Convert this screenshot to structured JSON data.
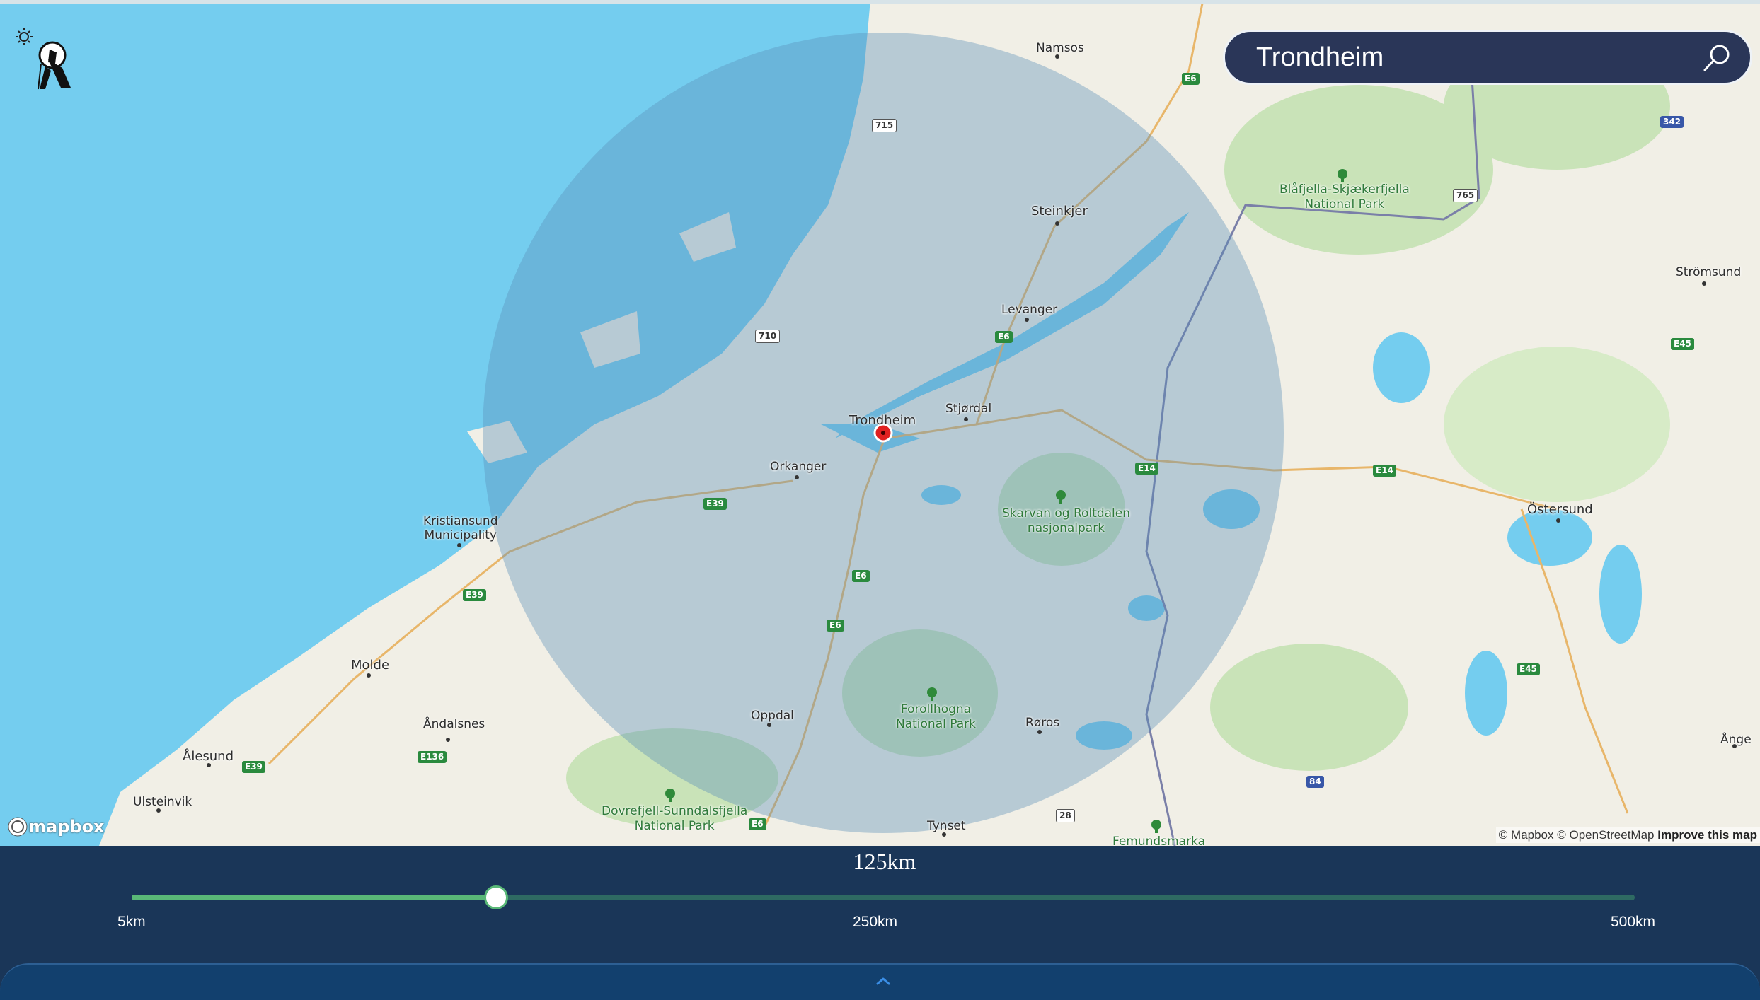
{
  "search": {
    "value": "Trondheim"
  },
  "map": {
    "center_label": "Trondheim",
    "places": {
      "namsos": "Namsos",
      "steinkjer": "Steinkjer",
      "levanger": "Levanger",
      "stjordal": "Stjørdal",
      "orkanger": "Orkanger",
      "kristiansund": "Kristiansund\nMunicipality",
      "molde": "Molde",
      "andalsnes": "Åndalsnes",
      "alesund": "Ålesund",
      "ulsteinvik": "Ulsteinvik",
      "oppdal": "Oppdal",
      "roros": "Røros",
      "tynset": "Tynset",
      "ostersund": "Östersund",
      "stromsund": "Strömsund",
      "ange": "Ånge"
    },
    "parks": {
      "blafjella": "Blåfjella-Skjækerfjella\nNational Park",
      "skarvan": "Skarvan og Roltdalen\nnasjonalpark",
      "forollhogna": "Forollhogna\nNational Park",
      "dovrefjell": "Dovrefjell-Sunndalsfjella\nNational Park",
      "femundsmarka": "Femundsmarka"
    },
    "shields": {
      "e6_a": "E6",
      "e6_b": "E6",
      "e6_c": "E6",
      "e6_d": "E6",
      "e6_e": "E6",
      "e14_a": "E14",
      "e14_b": "E14",
      "e39_a": "E39",
      "e39_b": "E39",
      "e39_c": "E39",
      "e136": "E136",
      "e45_a": "E45",
      "e45_b": "E45",
      "r715": "715",
      "r710": "710",
      "r765": "765",
      "r28": "28",
      "s342": "342",
      "s84": "84"
    },
    "mapbox_logo": "mapbox",
    "attribution_a": "© Mapbox © OpenStreetMap",
    "attribution_b": "Improve this map"
  },
  "radius": {
    "current_label": "125km",
    "current_km": 125,
    "min_km": 5,
    "max_km": 500,
    "min_label": "5km",
    "mid_label": "250km",
    "max_label": "500km"
  },
  "colors": {
    "water": "#74cdef",
    "land": "#f1efe6",
    "forest": "#c9e3b8",
    "radius_circle": "#5a8fb8",
    "slider_fill": "#59b877",
    "slider_track": "#2e6a62",
    "panel": "#1a3658",
    "marker": "#e02020"
  }
}
